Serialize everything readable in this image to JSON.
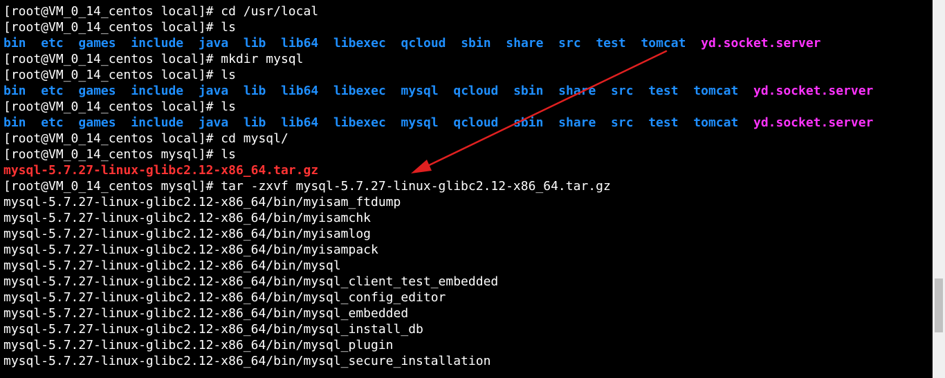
{
  "terminal": {
    "colors": {
      "background": "#000000",
      "text": "#ffffff",
      "directory": "#1f8fff",
      "executable": "#ff33ff",
      "archive": "#ff3333",
      "annotation_arrow": "#e02020"
    },
    "lines": [
      [
        {
          "text": "[root@VM_0_14_centos local]# cd /usr/local",
          "style": "plain"
        }
      ],
      [
        {
          "text": "[root@VM_0_14_centos local]# ls",
          "style": "plain"
        }
      ],
      [
        {
          "text": "bin",
          "style": "dir"
        },
        {
          "text": "  ",
          "style": "plain"
        },
        {
          "text": "etc",
          "style": "dir"
        },
        {
          "text": "  ",
          "style": "plain"
        },
        {
          "text": "games",
          "style": "dir"
        },
        {
          "text": "  ",
          "style": "plain"
        },
        {
          "text": "include",
          "style": "dir"
        },
        {
          "text": "  ",
          "style": "plain"
        },
        {
          "text": "java",
          "style": "dir"
        },
        {
          "text": "  ",
          "style": "plain"
        },
        {
          "text": "lib",
          "style": "dir"
        },
        {
          "text": "  ",
          "style": "plain"
        },
        {
          "text": "lib64",
          "style": "dir"
        },
        {
          "text": "  ",
          "style": "plain"
        },
        {
          "text": "libexec",
          "style": "dir"
        },
        {
          "text": "  ",
          "style": "plain"
        },
        {
          "text": "qcloud",
          "style": "dir"
        },
        {
          "text": "  ",
          "style": "plain"
        },
        {
          "text": "sbin",
          "style": "dir"
        },
        {
          "text": "  ",
          "style": "plain"
        },
        {
          "text": "share",
          "style": "dir"
        },
        {
          "text": "  ",
          "style": "plain"
        },
        {
          "text": "src",
          "style": "dir"
        },
        {
          "text": "  ",
          "style": "plain"
        },
        {
          "text": "test",
          "style": "dir"
        },
        {
          "text": "  ",
          "style": "plain"
        },
        {
          "text": "tomcat",
          "style": "dir"
        },
        {
          "text": "  ",
          "style": "plain"
        },
        {
          "text": "yd.socket.server",
          "style": "exec"
        }
      ],
      [
        {
          "text": "[root@VM_0_14_centos local]# mkdir mysql",
          "style": "plain"
        }
      ],
      [
        {
          "text": "[root@VM_0_14_centos local]# ls",
          "style": "plain"
        }
      ],
      [
        {
          "text": "bin",
          "style": "dir"
        },
        {
          "text": "  ",
          "style": "plain"
        },
        {
          "text": "etc",
          "style": "dir"
        },
        {
          "text": "  ",
          "style": "plain"
        },
        {
          "text": "games",
          "style": "dir"
        },
        {
          "text": "  ",
          "style": "plain"
        },
        {
          "text": "include",
          "style": "dir"
        },
        {
          "text": "  ",
          "style": "plain"
        },
        {
          "text": "java",
          "style": "dir"
        },
        {
          "text": "  ",
          "style": "plain"
        },
        {
          "text": "lib",
          "style": "dir"
        },
        {
          "text": "  ",
          "style": "plain"
        },
        {
          "text": "lib64",
          "style": "dir"
        },
        {
          "text": "  ",
          "style": "plain"
        },
        {
          "text": "libexec",
          "style": "dir"
        },
        {
          "text": "  ",
          "style": "plain"
        },
        {
          "text": "mysql",
          "style": "dir"
        },
        {
          "text": "  ",
          "style": "plain"
        },
        {
          "text": "qcloud",
          "style": "dir"
        },
        {
          "text": "  ",
          "style": "plain"
        },
        {
          "text": "sbin",
          "style": "dir"
        },
        {
          "text": "  ",
          "style": "plain"
        },
        {
          "text": "share",
          "style": "dir"
        },
        {
          "text": "  ",
          "style": "plain"
        },
        {
          "text": "src",
          "style": "dir"
        },
        {
          "text": "  ",
          "style": "plain"
        },
        {
          "text": "test",
          "style": "dir"
        },
        {
          "text": "  ",
          "style": "plain"
        },
        {
          "text": "tomcat",
          "style": "dir"
        },
        {
          "text": "  ",
          "style": "plain"
        },
        {
          "text": "yd.socket.server",
          "style": "exec"
        }
      ],
      [
        {
          "text": "[root@VM_0_14_centos local]# ls",
          "style": "plain"
        }
      ],
      [
        {
          "text": "bin",
          "style": "dir"
        },
        {
          "text": "  ",
          "style": "plain"
        },
        {
          "text": "etc",
          "style": "dir"
        },
        {
          "text": "  ",
          "style": "plain"
        },
        {
          "text": "games",
          "style": "dir"
        },
        {
          "text": "  ",
          "style": "plain"
        },
        {
          "text": "include",
          "style": "dir"
        },
        {
          "text": "  ",
          "style": "plain"
        },
        {
          "text": "java",
          "style": "dir"
        },
        {
          "text": "  ",
          "style": "plain"
        },
        {
          "text": "lib",
          "style": "dir"
        },
        {
          "text": "  ",
          "style": "plain"
        },
        {
          "text": "lib64",
          "style": "dir"
        },
        {
          "text": "  ",
          "style": "plain"
        },
        {
          "text": "libexec",
          "style": "dir"
        },
        {
          "text": "  ",
          "style": "plain"
        },
        {
          "text": "mysql",
          "style": "dir"
        },
        {
          "text": "  ",
          "style": "plain"
        },
        {
          "text": "qcloud",
          "style": "dir"
        },
        {
          "text": "  ",
          "style": "plain"
        },
        {
          "text": "sbin",
          "style": "dir"
        },
        {
          "text": "  ",
          "style": "plain"
        },
        {
          "text": "share",
          "style": "dir"
        },
        {
          "text": "  ",
          "style": "plain"
        },
        {
          "text": "src",
          "style": "dir"
        },
        {
          "text": "  ",
          "style": "plain"
        },
        {
          "text": "test",
          "style": "dir"
        },
        {
          "text": "  ",
          "style": "plain"
        },
        {
          "text": "tomcat",
          "style": "dir"
        },
        {
          "text": "  ",
          "style": "plain"
        },
        {
          "text": "yd.socket.server",
          "style": "exec"
        }
      ],
      [
        {
          "text": "[root@VM_0_14_centos local]# cd mysql/",
          "style": "plain"
        }
      ],
      [
        {
          "text": "[root@VM_0_14_centos mysql]# ls",
          "style": "plain"
        }
      ],
      [
        {
          "text": "mysql-5.7.27-linux-glibc2.12-x86_64.tar.gz",
          "style": "archive"
        }
      ],
      [
        {
          "text": "[root@VM_0_14_centos mysql]# tar -zxvf mysql-5.7.27-linux-glibc2.12-x86_64.tar.gz",
          "style": "plain"
        }
      ],
      [
        {
          "text": "mysql-5.7.27-linux-glibc2.12-x86_64/bin/myisam_ftdump",
          "style": "plain"
        }
      ],
      [
        {
          "text": "mysql-5.7.27-linux-glibc2.12-x86_64/bin/myisamchk",
          "style": "plain"
        }
      ],
      [
        {
          "text": "mysql-5.7.27-linux-glibc2.12-x86_64/bin/myisamlog",
          "style": "plain"
        }
      ],
      [
        {
          "text": "mysql-5.7.27-linux-glibc2.12-x86_64/bin/myisampack",
          "style": "plain"
        }
      ],
      [
        {
          "text": "mysql-5.7.27-linux-glibc2.12-x86_64/bin/mysql",
          "style": "plain"
        }
      ],
      [
        {
          "text": "mysql-5.7.27-linux-glibc2.12-x86_64/bin/mysql_client_test_embedded",
          "style": "plain"
        }
      ],
      [
        {
          "text": "mysql-5.7.27-linux-glibc2.12-x86_64/bin/mysql_config_editor",
          "style": "plain"
        }
      ],
      [
        {
          "text": "mysql-5.7.27-linux-glibc2.12-x86_64/bin/mysql_embedded",
          "style": "plain"
        }
      ],
      [
        {
          "text": "mysql-5.7.27-linux-glibc2.12-x86_64/bin/mysql_install_db",
          "style": "plain"
        }
      ],
      [
        {
          "text": "mysql-5.7.27-linux-glibc2.12-x86_64/bin/mysql_plugin",
          "style": "plain"
        }
      ],
      [
        {
          "text": "mysql-5.7.27-linux-glibc2.12-x86_64/bin/mysql_secure_installation",
          "style": "plain"
        }
      ]
    ]
  },
  "scrollbar": {
    "position_fraction": 0.74
  },
  "annotation": {
    "shape": "arrow",
    "from": "tomcat",
    "to": "mysql-5.7.27-linux-glibc2.12-x86_64.tar.gz"
  }
}
